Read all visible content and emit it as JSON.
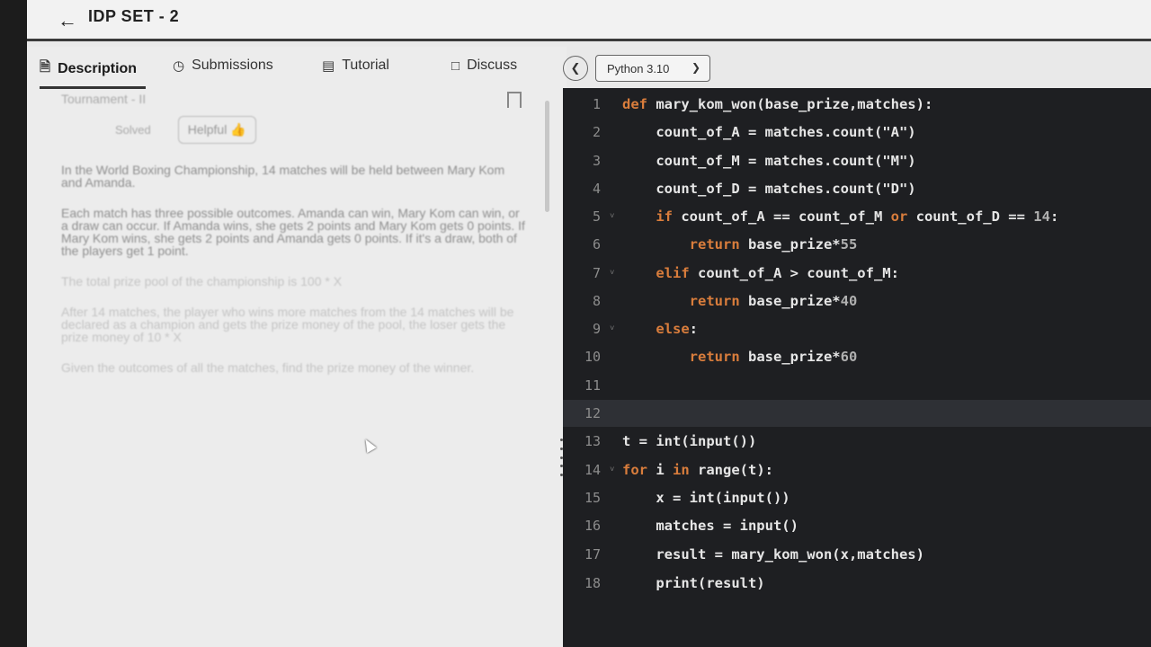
{
  "header": {
    "title": "IDP SET - 2",
    "back_icon": "arrow-left-icon"
  },
  "tabs": [
    {
      "label": "Description",
      "icon": "document-icon",
      "active": true
    },
    {
      "label": "Submissions",
      "icon": "clock-icon"
    },
    {
      "label": "Tutorial",
      "icon": "book-icon"
    },
    {
      "label": "Discuss",
      "icon": "chat-icon"
    }
  ],
  "editor_toolbar": {
    "language": "Python 3.10"
  },
  "description": {
    "heading": "Tournament - II",
    "status": "Solved",
    "helpful_label": "Helpful",
    "paragraphs": [
      "In the World Boxing Championship, 14 matches will be held between Mary Kom and Amanda.",
      "Each match has three possible outcomes. Amanda can win, Mary Kom can win, or a draw can occur. If Amanda wins, she gets 2 points and Mary Kom gets 0 points. If Mary Kom wins, she gets 2 points and Amanda gets 0 points. If it's a draw, both of the players get 1 point.",
      "The total prize pool of the championship is 100 * X",
      "After 14 matches, the player who wins more matches from the 14 matches will be declared as a champion and gets the prize money of the pool, the loser gets the prize money of 10 * X",
      "Given the outcomes of all the matches, find the prize money of the winner."
    ]
  },
  "code_lines": [
    {
      "n": "1",
      "fold": false,
      "html": "<span class=\"kw\">def</span> mary_kom_won(base_prize,matches):"
    },
    {
      "n": "2",
      "fold": false,
      "html": "    count_of_A = matches.count(\"A\")"
    },
    {
      "n": "3",
      "fold": false,
      "html": "    count_of_M = matches.count(\"M\")"
    },
    {
      "n": "4",
      "fold": false,
      "html": "    count_of_D = matches.count(\"D\")"
    },
    {
      "n": "5",
      "fold": true,
      "html": "    <span class=\"kw\">if</span> count_of_A == count_of_M <span class=\"kw\">or</span> count_of_D == <span class=\"num\">14</span>:"
    },
    {
      "n": "6",
      "fold": false,
      "html": "        <span class=\"kw\">return</span> base_prize*<span class=\"num\">55</span>"
    },
    {
      "n": "7",
      "fold": true,
      "html": "    <span class=\"kw\">elif</span> count_of_A &gt; count_of_M:"
    },
    {
      "n": "8",
      "fold": false,
      "html": "        <span class=\"kw\">return</span> base_prize*<span class=\"num\">40</span>"
    },
    {
      "n": "9",
      "fold": true,
      "html": "    <span class=\"kw\">else</span>:"
    },
    {
      "n": "10",
      "fold": false,
      "html": "        <span class=\"kw\">return</span> base_prize*<span class=\"num\">60</span>"
    },
    {
      "n": "11",
      "fold": false,
      "html": ""
    },
    {
      "n": "12",
      "fold": false,
      "html": "",
      "current": true
    },
    {
      "n": "13",
      "fold": false,
      "html": "t = int(input())"
    },
    {
      "n": "14",
      "fold": true,
      "html": "<span class=\"kw\">for</span> i <span class=\"kw\">in</span> range(t):"
    },
    {
      "n": "15",
      "fold": false,
      "html": "    x = int(input())"
    },
    {
      "n": "16",
      "fold": false,
      "html": "    matches = input()"
    },
    {
      "n": "17",
      "fold": false,
      "html": "    result = mary_kom_won(x,matches)"
    },
    {
      "n": "18",
      "fold": false,
      "html": "    print(result)"
    }
  ],
  "colors": {
    "editor_bg": "#1e1f22",
    "keyword": "#d97d3c",
    "panel_bg": "#ececec"
  }
}
